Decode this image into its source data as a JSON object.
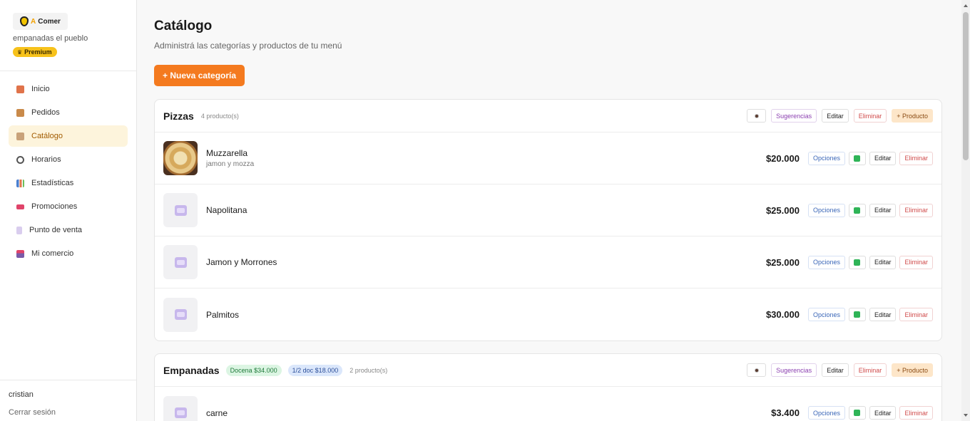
{
  "sidebar": {
    "logo": {
      "part_a": "A",
      "part_b": "Comer"
    },
    "store_name": "empanadas el pueblo",
    "plan_badge": "Premium",
    "items": [
      {
        "label": "Inicio",
        "icon": "house-icon",
        "color": "#e0734a"
      },
      {
        "label": "Pedidos",
        "icon": "package-icon",
        "color": "#c98a4a"
      },
      {
        "label": "Catálogo",
        "icon": "clipboard-icon",
        "color": "#c9a27a",
        "active": true
      },
      {
        "label": "Horarios",
        "icon": "clock-icon",
        "color": "#555555"
      },
      {
        "label": "Estadísticas",
        "icon": "bar-chart-icon",
        "color": "#4a7fd0"
      },
      {
        "label": "Promociones",
        "icon": "ticket-icon",
        "color": "#e0446a"
      },
      {
        "label": "Punto de venta",
        "icon": "receipt-icon",
        "color": "#b5a3d8"
      },
      {
        "label": "Mi comercio",
        "icon": "store-icon",
        "color": "#7a5aa8"
      }
    ],
    "user": "cristian",
    "logout": "Cerrar sesión"
  },
  "header": {
    "title": "Catálogo",
    "subtitle": "Administrá las categorías y productos de tu menú",
    "new_category": "+ Nueva categoría"
  },
  "actions": {
    "suggestions": "Sugerencias",
    "edit": "Editar",
    "delete": "Eliminar",
    "add_product": "+ Producto",
    "options": "Opciones"
  },
  "categories": [
    {
      "name": "Pizzas",
      "count": "4 producto(s)",
      "badges": [],
      "products": [
        {
          "name": "Muzzarella",
          "description": "jamon y mozza",
          "price": "$20.000",
          "has_photo": true
        },
        {
          "name": "Napolitana",
          "description": "",
          "price": "$25.000",
          "has_photo": false
        },
        {
          "name": "Jamon y Morrones",
          "description": "",
          "price": "$25.000",
          "has_photo": false
        },
        {
          "name": "Palmitos",
          "description": "",
          "price": "$30.000",
          "has_photo": false
        }
      ]
    },
    {
      "name": "Empanadas",
      "count": "2 producto(s)",
      "badges": [
        {
          "text": "Docena $34.000",
          "style": "green"
        },
        {
          "text": "1/2 doc $18.000",
          "style": "blue"
        }
      ],
      "products": [
        {
          "name": "carne",
          "description": "",
          "price": "$3.400",
          "has_photo": false
        }
      ]
    }
  ],
  "colors": {
    "accent": "#f47a1f",
    "premium": "#f7c21b",
    "available_check": "#2fb457"
  }
}
